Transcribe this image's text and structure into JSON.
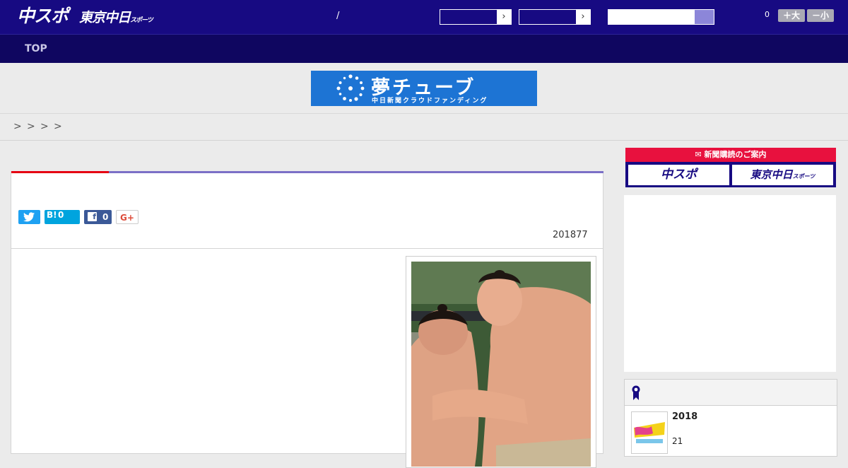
{
  "header": {
    "logo_chuspo": "中スポ",
    "logo_tokyo": "東京中日",
    "logo_tokyo_suffix": "スポーツ",
    "separator": "/",
    "like_count": "0",
    "font_larger": "＋大",
    "font_smaller": "－小"
  },
  "nav": {
    "top": "TOP"
  },
  "ad_banner": {
    "title": "夢チューブ",
    "subtitle": "中日新聞クラウドファンディング"
  },
  "breadcrumbs": [
    ">",
    ">",
    ">",
    ">"
  ],
  "article": {
    "hatena_count": "0",
    "facebook_count": "0",
    "date": "201877"
  },
  "subscription": {
    "header": "新聞購読のご案内",
    "chuspo": "中スポ",
    "tokyo": "東京中日",
    "tokyo_suffix": "スポーツ"
  },
  "ranking": {
    "items": [
      {
        "title": "2018",
        "subtitle": "21"
      }
    ]
  },
  "colors": {
    "header_bg": "#170a82",
    "nav_bg": "#0f0660",
    "accent_red": "#e50012",
    "accent_purple": "#7b6fc6",
    "twitter": "#1ea1f2",
    "hatena": "#00a4de",
    "facebook": "#3b5998",
    "banner_blue": "#1d74d4"
  }
}
